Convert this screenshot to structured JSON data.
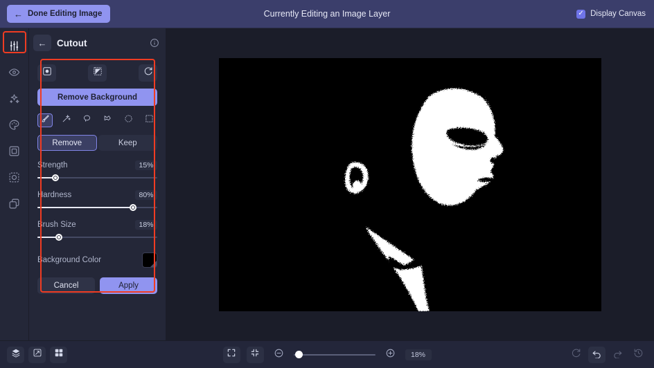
{
  "topbar": {
    "done_button": "Done Editing Image",
    "back_arrow": "←",
    "title": "Currently Editing an Image Layer",
    "display_canvas_label": "Display Canvas",
    "display_canvas_checked": true,
    "checkmark": "✓",
    "accent_color": "#9094f0",
    "background_color": "#3b3e6b"
  },
  "rail": {
    "items": [
      {
        "name": "adjust-sliders-icon",
        "label": "Adjust",
        "active": true
      },
      {
        "name": "eye-icon",
        "label": "Visibility",
        "active": false
      },
      {
        "name": "sparkles-icon",
        "label": "Effects",
        "active": false
      },
      {
        "name": "palette-icon",
        "label": "Color",
        "active": false
      },
      {
        "name": "frame-icon",
        "label": "Frame",
        "active": false
      },
      {
        "name": "cutout-icon",
        "label": "Cutout",
        "active": false
      },
      {
        "name": "layers-copy-icon",
        "label": "Duplicate",
        "active": false
      }
    ]
  },
  "panel": {
    "back_arrow": "←",
    "title": "Cutout",
    "info_icon": "i",
    "mode_icons": [
      {
        "name": "cutout-mask-icon",
        "label": "Mask"
      },
      {
        "name": "invert-selection-icon",
        "label": "Invert"
      },
      {
        "name": "reset-icon",
        "label": "Reset"
      }
    ],
    "remove_background_label": "Remove Background",
    "tools": [
      {
        "name": "brush-tool",
        "label": "Brush",
        "active": true
      },
      {
        "name": "magic-wand-tool",
        "label": "Magic Wand",
        "active": false
      },
      {
        "name": "lasso-tool",
        "label": "Lasso",
        "active": false
      },
      {
        "name": "polygon-lasso-tool",
        "label": "Polygon Lasso",
        "active": false
      },
      {
        "name": "ellipse-select-tool",
        "label": "Ellipse Select",
        "active": false
      },
      {
        "name": "rectangle-marquee-tool",
        "label": "Rectangle Marquee",
        "active": false
      }
    ],
    "segmented": {
      "remove_label": "Remove",
      "keep_label": "Keep",
      "selected": "Remove"
    },
    "sliders": [
      {
        "name": "strength-slider",
        "label": "Strength",
        "value_text": "15%",
        "value": 15
      },
      {
        "name": "hardness-slider",
        "label": "Hardness",
        "value_text": "80%",
        "value": 80
      },
      {
        "name": "brush-size-slider",
        "label": "Brush Size",
        "value_text": "18%",
        "value": 18
      }
    ],
    "background_color_label": "Background Color",
    "background_color_value": "#000000",
    "cancel_label": "Cancel",
    "apply_label": "Apply"
  },
  "bottombar": {
    "left_icons": [
      {
        "name": "layers-icon",
        "label": "Layers"
      },
      {
        "name": "transform-icon",
        "label": "Transform"
      },
      {
        "name": "grid-icon",
        "label": "Grid"
      }
    ],
    "fit_screen_label": "Fit to Screen",
    "fit_content_label": "Fit Content",
    "zoom_out_label": "Zoom Out",
    "zoom_in_label": "Zoom In",
    "zoom_value": "18%",
    "zoom_percent": 18,
    "right_icons": [
      {
        "name": "refresh-icon",
        "label": "Reset View",
        "dim": true
      },
      {
        "name": "undo-icon",
        "label": "Undo",
        "dim": false
      },
      {
        "name": "redo-icon",
        "label": "Redo",
        "dim": true
      },
      {
        "name": "history-icon",
        "label": "History",
        "dim": true
      }
    ]
  },
  "canvas": {
    "image_description": "High-contrast black and white profile portrait of a man facing right",
    "image_name": "portrait-bw-profile",
    "background": "#000000"
  }
}
